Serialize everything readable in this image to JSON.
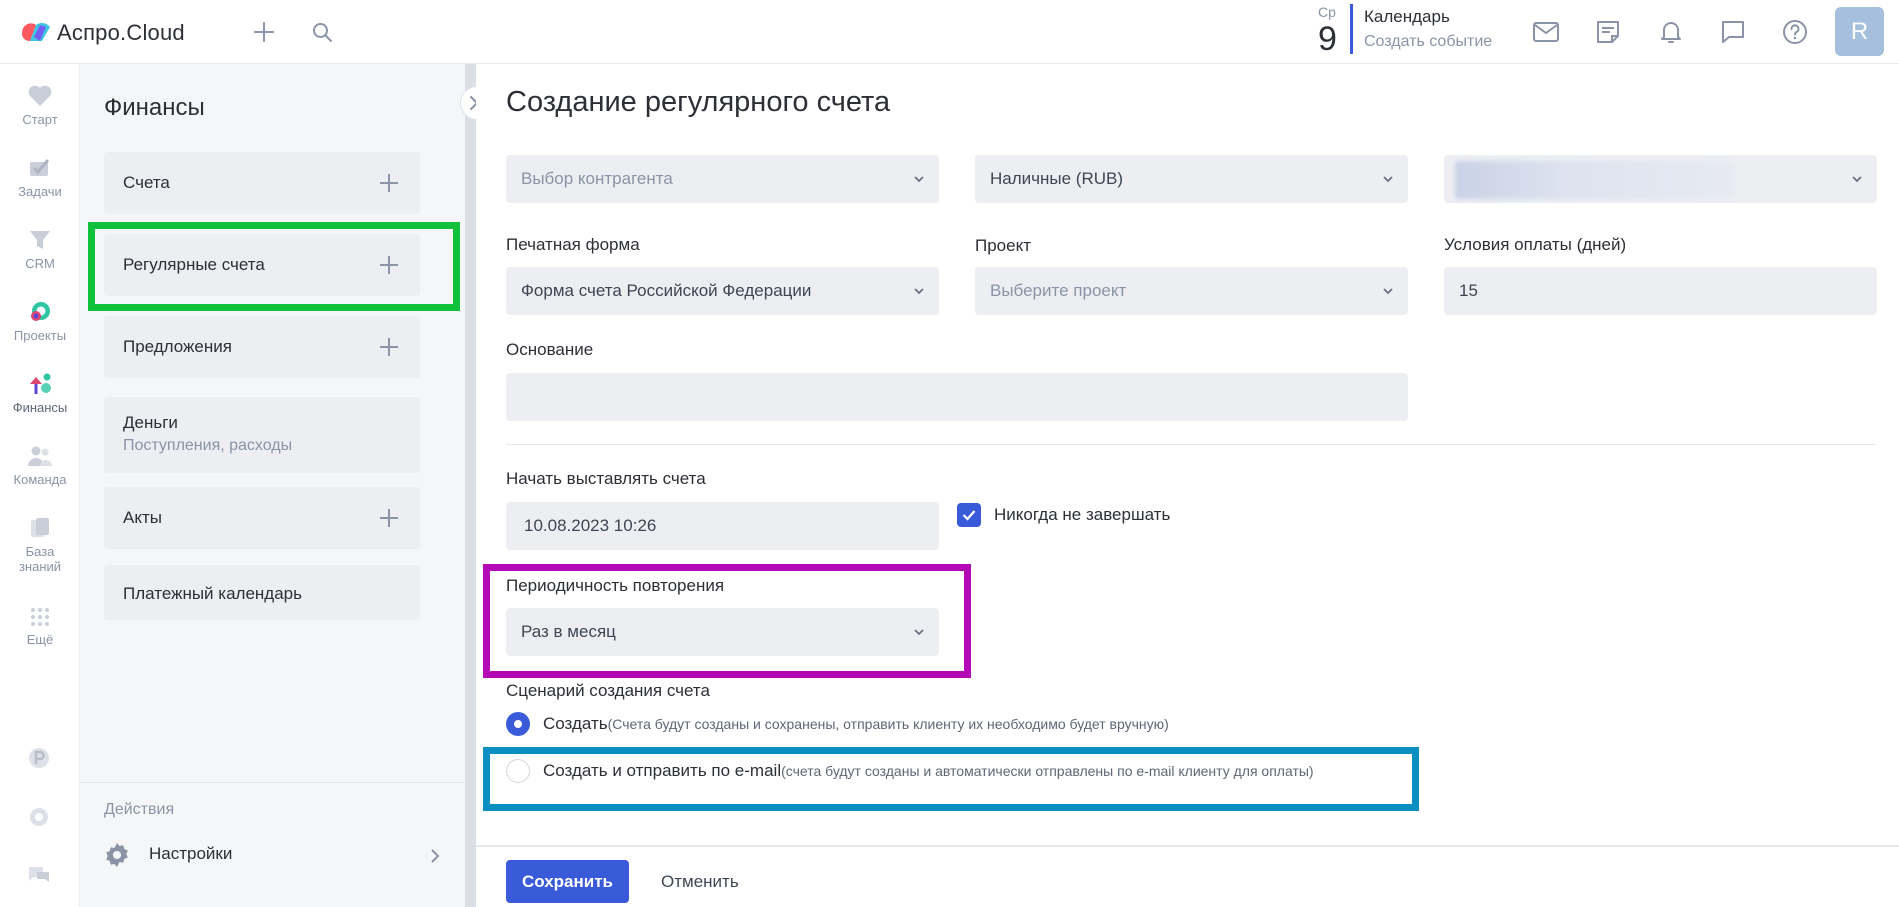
{
  "app": {
    "logo_text": "Аспро.Cloud"
  },
  "topbar": {
    "calendar_day_short": "Ср",
    "calendar_day_num": "9",
    "calendar_title": "Календарь",
    "calendar_link": "Создать событие",
    "avatar_letter": "R"
  },
  "rail": {
    "items": [
      {
        "label": "Старт",
        "icon": "heart-icon"
      },
      {
        "label": "Задачи",
        "icon": "tasks-icon"
      },
      {
        "label": "CRM",
        "icon": "funnel-icon"
      },
      {
        "label": "Проекты",
        "icon": "projects-icon"
      },
      {
        "label": "Финансы",
        "icon": "finance-icon"
      },
      {
        "label": "Команда",
        "icon": "team-icon"
      },
      {
        "label": "База знаний",
        "icon": "knowledge-icon"
      },
      {
        "label": "Ещё",
        "icon": "grid-icon"
      }
    ]
  },
  "panel": {
    "title": "Финансы",
    "menu": [
      {
        "label": "Счета"
      },
      {
        "label": "Регулярные счета"
      },
      {
        "label": "Предложения"
      },
      {
        "label": "Деньги",
        "sub": "Поступления, расходы"
      },
      {
        "label": "Акты"
      },
      {
        "label": "Платежный календарь"
      }
    ],
    "actions_label": "Действия",
    "settings_label": "Настройки"
  },
  "form": {
    "title": "Создание регулярного счета",
    "counterparty_value": "Выбор контрагента",
    "cash_value": "Наличные (RUB)",
    "print_form_label": "Печатная форма",
    "print_form_value": "Форма счета Российской Федерации",
    "project_label": "Проект",
    "project_placeholder": "Выберите проект",
    "payment_terms_label": "Условия оплаты (дней)",
    "payment_terms_value": "15",
    "basis_label": "Основание",
    "start_label": "Начать выставлять счета",
    "start_value": "10.08.2023 10:26",
    "never_end_label": "Никогда не завершать",
    "never_end_checked": true,
    "periodicity_label": "Периодичность повторения",
    "periodicity_value": "Раз в месяц",
    "scenario_label": "Сценарий создания счета",
    "scenario_create_label": "Создать",
    "scenario_create_hint": "(Счета будут созданы и сохранены, отправить клиенту их необходимо будет вручную)",
    "scenario_send_label": "Создать и отправить по e-mail",
    "scenario_send_hint": "(счета будут созданы и автоматически отправлены по e-mail клиенту для оплаты)"
  },
  "footer": {
    "save_label": "Сохранить",
    "cancel_label": "Отменить"
  },
  "colors": {
    "accent": "#3a5bd9",
    "highlight_green": "#12c13b",
    "highlight_magenta": "#b30ab6",
    "highlight_blue": "#0b8fc2"
  }
}
